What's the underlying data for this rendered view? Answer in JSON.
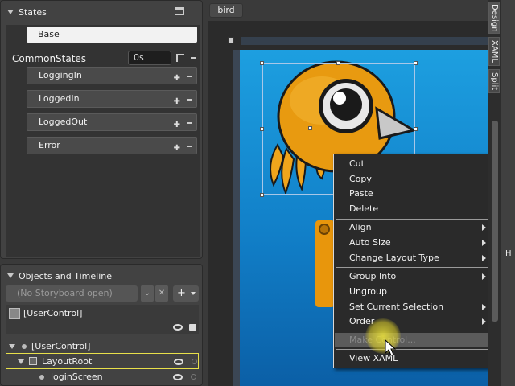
{
  "states_panel": {
    "title": "States",
    "base_state": "Base",
    "group": {
      "name": "CommonStates",
      "duration": "0s"
    },
    "states": [
      "LoggingIn",
      "LoggedIn",
      "LoggedOut",
      "Error"
    ]
  },
  "objects_panel": {
    "title": "Objects and Timeline",
    "storyboard_placeholder": "(No Storyboard open)",
    "add_label": "+",
    "root_label": "[UserControl]",
    "tree": [
      {
        "label": "[UserControl]"
      },
      {
        "label": "LayoutRoot"
      },
      {
        "label": "loginScreen"
      }
    ]
  },
  "document_tab": "bird",
  "view_tabs": [
    "Design",
    "XAML",
    "Split"
  ],
  "far_right_label": "H",
  "context_menu": {
    "items": [
      {
        "label": "Cut"
      },
      {
        "label": "Copy"
      },
      {
        "label": "Paste"
      },
      {
        "label": "Delete"
      },
      {
        "label": "Align"
      },
      {
        "label": "Auto Size"
      },
      {
        "label": "Change Layout Type"
      },
      {
        "label": "Group Into"
      },
      {
        "label": "Ungroup"
      },
      {
        "label": "Set Current Selection"
      },
      {
        "label": "Order"
      },
      {
        "label": "Make Control..."
      },
      {
        "label": "View XAML"
      }
    ]
  }
}
